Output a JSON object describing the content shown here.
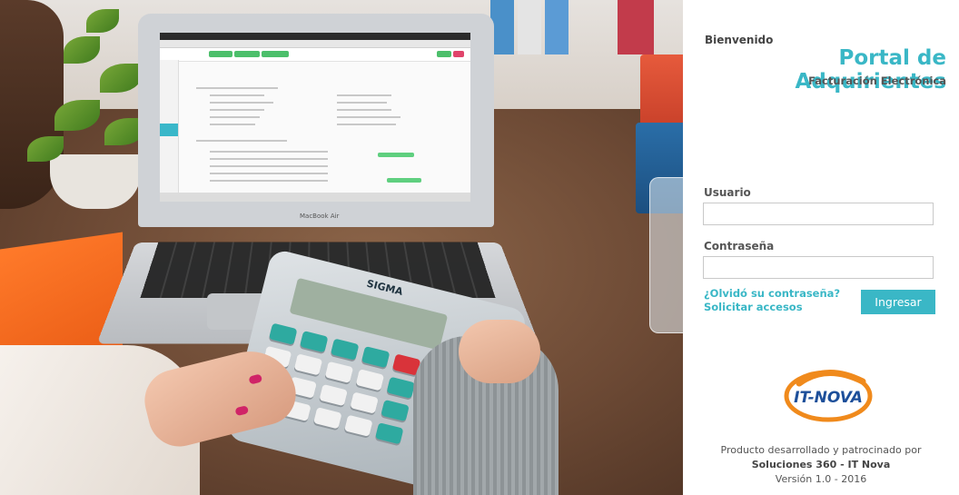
{
  "hero": {
    "laptop_brand": "MacBook Air",
    "calculator_brand": "SIGMA"
  },
  "login": {
    "welcome": "Bienvenido",
    "title": "Portal de Adquirientes",
    "subtitle": "Facturación Electrónica",
    "username_label": "Usuario",
    "username_value": "",
    "password_label": "Contraseña",
    "password_value": "",
    "forgot_link": "¿Olvidó su contraseña?",
    "request_link": "Solicitar accesos",
    "submit_label": "Ingresar"
  },
  "logo": {
    "text": "IT-NOVA"
  },
  "footer": {
    "line1": "Producto desarrollado y patrocinado por",
    "line2": "Soluciones 360 - IT Nova",
    "line3": "Versión 1.0 - 2016"
  },
  "colors": {
    "accent": "#3ab7c6",
    "logo_orange": "#f08a1c",
    "logo_blue": "#1d4f9a"
  }
}
